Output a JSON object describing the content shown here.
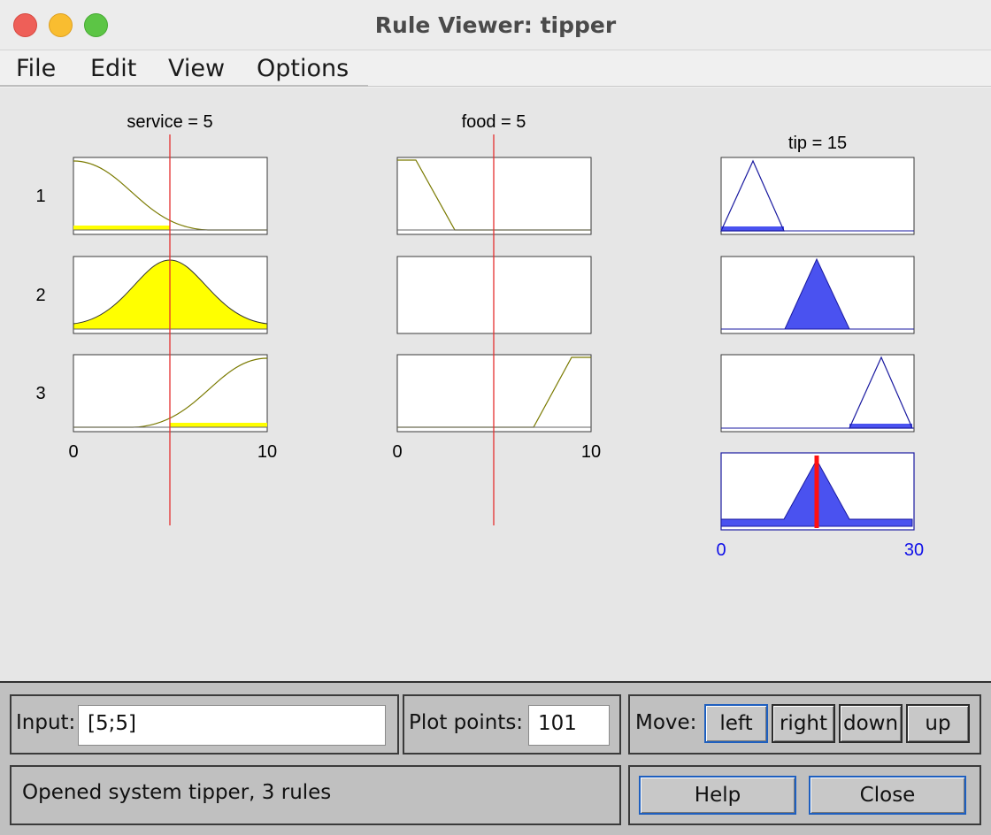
{
  "window": {
    "title": "Rule Viewer: tipper",
    "traffic_lights": [
      "close",
      "minimize",
      "zoom"
    ]
  },
  "menu": [
    "File",
    "Edit",
    "View",
    "Options"
  ],
  "plots": {
    "service_label": "service = 5",
    "food_label": "food = 5",
    "tip_label": "tip = 15",
    "rule_numbers": [
      "1",
      "2",
      "3"
    ],
    "service_axis": [
      "0",
      "10"
    ],
    "food_axis": [
      "0",
      "10"
    ],
    "tip_axis": [
      "0",
      "30"
    ]
  },
  "colors": {
    "input_fill": "#ffff00",
    "output_fill": "#4a52f0",
    "index_line": "#e53030",
    "output_axis_text": "#1010e8"
  },
  "controls": {
    "input_label": "Input:",
    "input_value": "[5;5]",
    "plot_points_label": "Plot points:",
    "plot_points_value": "101",
    "move_label": "Move:",
    "move_buttons": [
      "left",
      "right",
      "down",
      "up"
    ],
    "status": "Opened system tipper, 3 rules",
    "help": "Help",
    "close": "Close"
  }
}
